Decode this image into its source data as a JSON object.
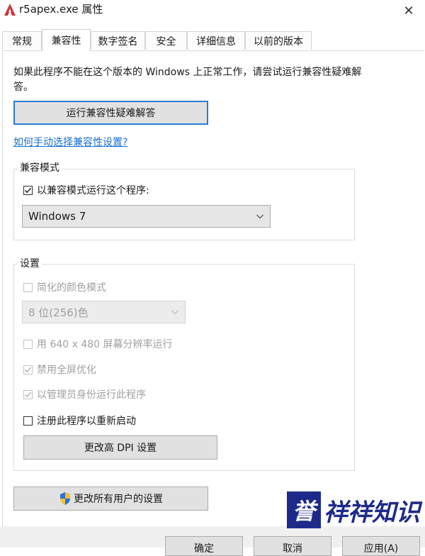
{
  "window": {
    "title": "r5apex.exe 属性",
    "close_glyph": "✕",
    "app_icon": "apex-logo-icon"
  },
  "tabs": [
    {
      "label": "常规",
      "active": false
    },
    {
      "label": "兼容性",
      "active": true
    },
    {
      "label": "数字签名",
      "active": false
    },
    {
      "label": "安全",
      "active": false
    },
    {
      "label": "详细信息",
      "active": false
    },
    {
      "label": "以前的版本",
      "active": false
    }
  ],
  "intro": {
    "description": "如果此程序不能在这个版本的 Windows 上正常工作，请尝试运行兼容性疑难解答。",
    "troubleshoot_button": "运行兼容性疑难解答",
    "manual_link": "如何手动选择兼容性设置?"
  },
  "compat_mode": {
    "group_title": "兼容模式",
    "checkbox_label": "以兼容模式运行这个程序:",
    "checked": true,
    "selected_os": "Windows 7"
  },
  "settings": {
    "group_title": "设置",
    "reduced_color": {
      "label": "简化的颜色模式",
      "checked": false,
      "enabled": false
    },
    "color_select": "8 位(256)色",
    "run_640": {
      "label": "用 640 x 480 屏幕分辨率运行",
      "checked": false,
      "enabled": false
    },
    "disable_fullscreen": {
      "label": "禁用全屏优化",
      "checked": true,
      "enabled": false
    },
    "run_as_admin": {
      "label": "以管理员身份运行此程序",
      "checked": true,
      "enabled": false
    },
    "register_restart": {
      "label": "注册此程序以重新启动",
      "checked": false,
      "enabled": true
    },
    "dpi_button": "更改高 DPI 设置"
  },
  "all_users_button": "更改所有用户的设置",
  "footer": {
    "ok": "确定",
    "cancel": "取消",
    "apply": "应用(A)"
  },
  "watermark": {
    "box_text": "誉",
    "rest_text": "祥祥知识"
  },
  "colors": {
    "accent": "#2b7bd6",
    "link": "#1a6fcf",
    "app_icon": "#d0333a",
    "watermark": "#1e2a8a"
  }
}
